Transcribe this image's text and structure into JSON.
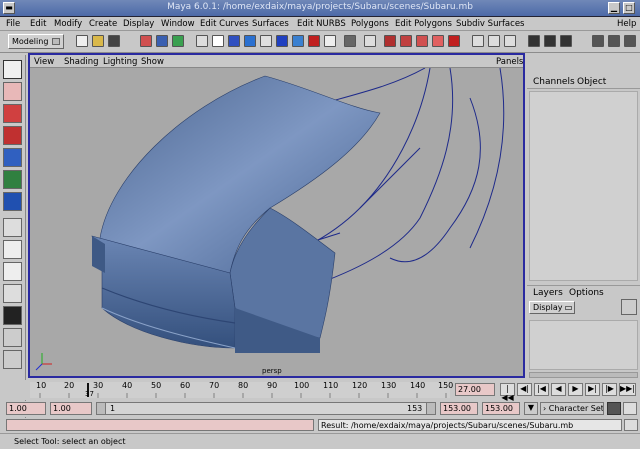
{
  "window": {
    "title": "Maya 6.0.1: /home/exdaix/maya/projects/Subaru/scenes/Subaru.mb"
  },
  "menubar": [
    "File",
    "Edit",
    "Modify",
    "Create",
    "Display",
    "Window",
    "Edit Curves",
    "Surfaces",
    "Edit NURBS",
    "Polygons",
    "Edit Polygons",
    "Subdiv Surfaces",
    "Help"
  ],
  "shelf": {
    "mode": "Modeling"
  },
  "viewport": {
    "menu": [
      "View",
      "Shading",
      "Lighting",
      "Show"
    ],
    "panels": "Panels",
    "camera_label": "persp",
    "colors": {
      "background": "#a8a8a8",
      "surface": "#5e79a6",
      "wire": "#1e2a8a"
    }
  },
  "channels": {
    "tabs": [
      "Channels",
      "Object"
    ]
  },
  "layers": {
    "tabs": [
      "Layers",
      "Options"
    ],
    "display": "Display"
  },
  "timeline": {
    "ticks": [
      "10",
      "20",
      "30",
      "40",
      "50",
      "60",
      "70",
      "80",
      "90",
      "100",
      "110",
      "120",
      "130",
      "140",
      "150"
    ],
    "current_marker": "37",
    "current_frame": "27.00"
  },
  "range": {
    "start": "1.00",
    "start2": "1.00",
    "slider_left": "1",
    "slider_right": "153",
    "end": "153.00",
    "end2": "153.00",
    "character_set": "Character Set"
  },
  "command": {
    "result": "Result: /home/exdaix/maya/projects/Subaru/scenes/Subaru.mb"
  },
  "help": {
    "text": "Select Tool: select an object"
  }
}
